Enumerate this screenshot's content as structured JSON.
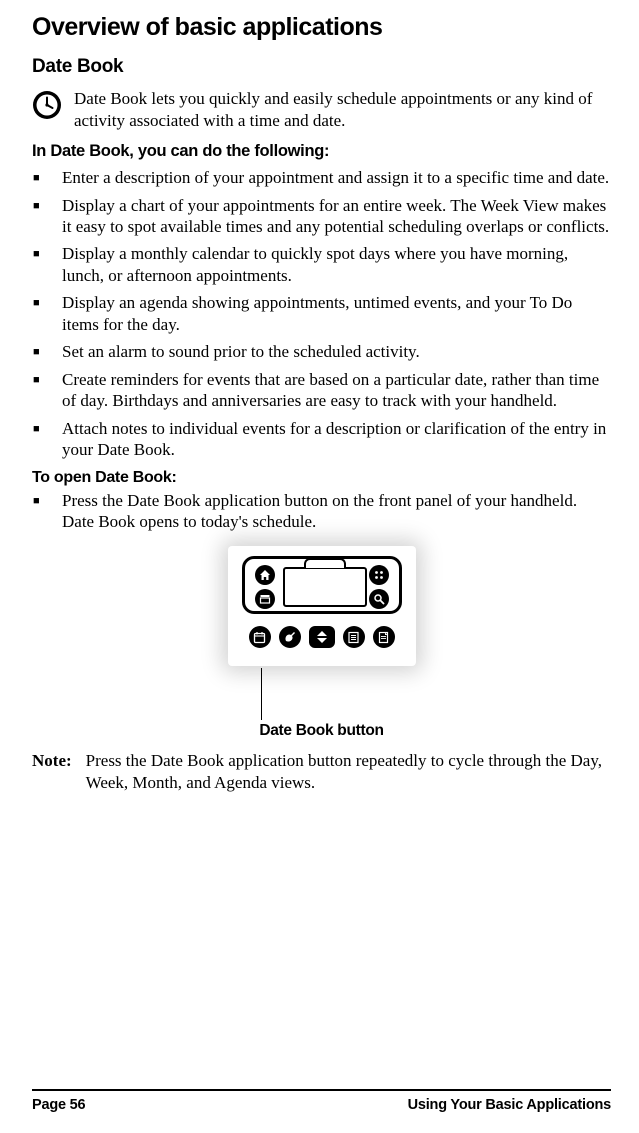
{
  "h1": "Overview of basic applications",
  "h2": "Date Book",
  "intro": "Date Book lets you quickly and easily schedule appointments or any kind of activity associated with a time and date.",
  "h3a": "In Date Book, you can do the following:",
  "bullets_a": [
    "Enter a description of your appointment and assign it to a specific time and date.",
    "Display a chart of your appointments for an entire week. The Week View makes it easy to spot available times and any potential scheduling overlaps or conflicts.",
    "Display a monthly calendar to quickly spot days where you have morning, lunch, or afternoon appointments.",
    "Display an agenda showing appointments, untimed events, and your To Do items for the day.",
    "Set an alarm to sound prior to the scheduled activity.",
    "Create reminders for events that are based on a particular date, rather than time of day. Birthdays and anniversaries are easy to track with your handheld.",
    "Attach notes to individual events for a description or clarification of the entry in your Date Book."
  ],
  "h4a": "To open Date Book:",
  "bullets_b": [
    "Press the Date Book application button on the front panel of your handheld. Date Book opens to today's schedule."
  ],
  "callout": "Date Book button",
  "note_label": "Note:",
  "note_text": "Press the Date Book application button repeatedly to cycle through the Day, Week, Month, and Agenda views.",
  "footer_left": "Page 56",
  "footer_right": "Using Your Basic Applications"
}
